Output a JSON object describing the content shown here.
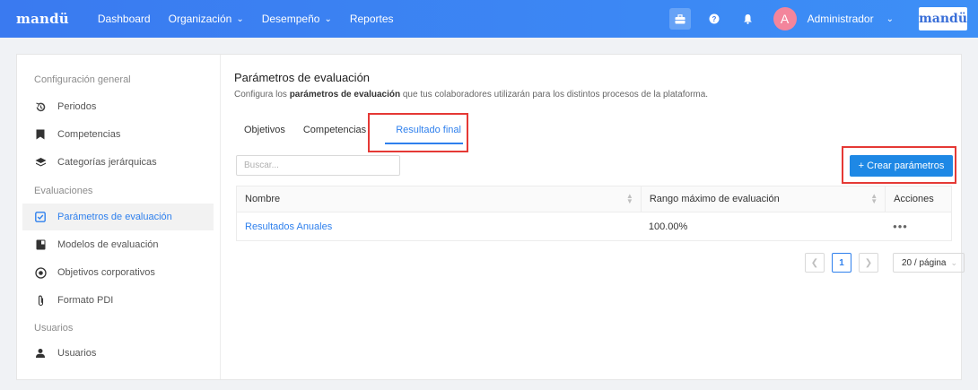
{
  "header": {
    "logo": "mandü",
    "nav": [
      {
        "label": "Dashboard",
        "dropdown": false
      },
      {
        "label": "Organización",
        "dropdown": true
      },
      {
        "label": "Desempeño",
        "dropdown": true
      },
      {
        "label": "Reportes",
        "dropdown": false
      }
    ],
    "icons": [
      "briefcase-icon",
      "help-icon",
      "bell-icon"
    ],
    "user": {
      "initial": "A",
      "name": "Administrador"
    },
    "brand": "mandü",
    "accent": "#3a7af0"
  },
  "sidebar": {
    "sections": [
      {
        "heading": "Configuración general",
        "items": [
          {
            "label": "Periodos",
            "icon": "history-icon"
          },
          {
            "label": "Competencias",
            "icon": "bookmark-icon"
          },
          {
            "label": "Categorías jerárquicas",
            "icon": "layers-icon"
          }
        ]
      },
      {
        "heading": "Evaluaciones",
        "items": [
          {
            "label": "Parámetros de evaluación",
            "icon": "checkbox-icon",
            "active": true
          },
          {
            "label": "Modelos de evaluación",
            "icon": "book-icon"
          },
          {
            "label": "Objetivos corporativos",
            "icon": "target-icon"
          },
          {
            "label": "Formato PDI",
            "icon": "paperclip-icon"
          }
        ]
      },
      {
        "heading": "Usuarios",
        "items": [
          {
            "label": "Usuarios",
            "icon": "user-icon"
          }
        ]
      }
    ]
  },
  "main": {
    "title": "Parámetros de evaluación",
    "subtitle_pre": "Configura los ",
    "subtitle_bold": "parámetros de evaluación",
    "subtitle_post": " que tus colaboradores utilizarán para los distintos procesos de la plataforma.",
    "tabs": [
      {
        "label": "Objetivos"
      },
      {
        "label": "Competencias"
      },
      {
        "label": "Resultado final",
        "active": true
      }
    ],
    "search_placeholder": "Buscar...",
    "create_button": "+ Crear parámetros",
    "table": {
      "columns": [
        "Nombre",
        "Rango máximo de evaluación",
        "Acciones"
      ],
      "rows": [
        {
          "name": "Resultados Anuales",
          "range": "100.00%",
          "actions": "•••"
        }
      ]
    },
    "pagination": {
      "current": "1",
      "page_size": "20 / página"
    },
    "highlight_color": "#e53935"
  }
}
